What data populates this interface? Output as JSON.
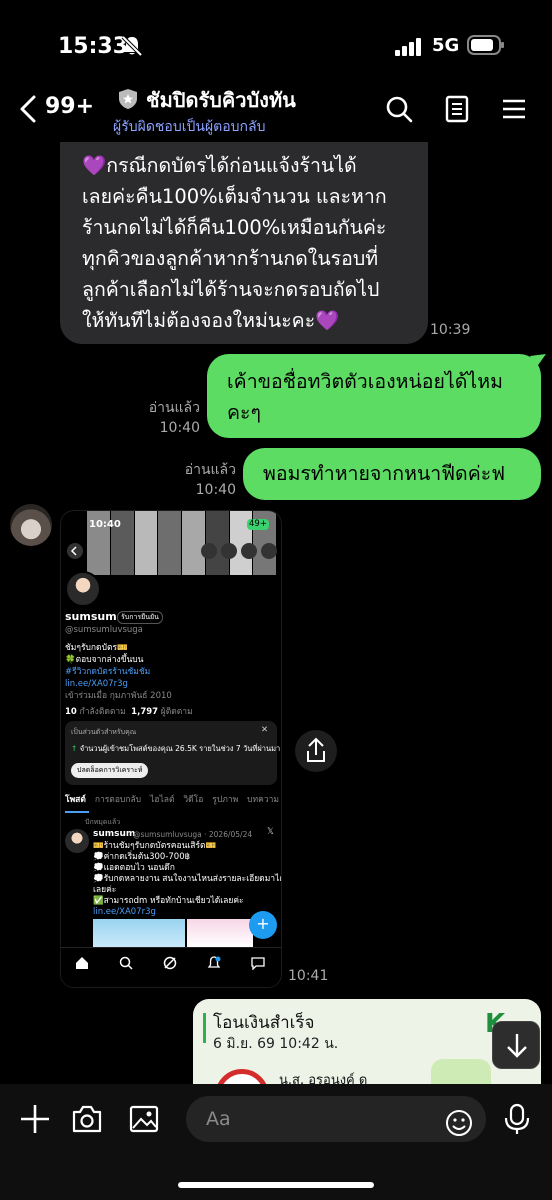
{
  "status_bar": {
    "time": "15:33",
    "network": "5G"
  },
  "header": {
    "unread_count": "99+",
    "title": "ชัมปิดรับคิวบังทัน",
    "subtitle": "ผู้รับผิดชอบเป็นผู้ตอบกลับ"
  },
  "messages": [
    {
      "direction": "in",
      "lines": [
        "💜กรณีกดบัตรได้ก่อนแจ้งร้านได้",
        "เลยค่ะคืน100%เต็มจำนวน และหาก",
        "ร้านกดไม่ได้ก็คืน100%เหมือนกันค่ะ",
        "ทุกคิวของลูกค้าหากร้านกดในรอบที่",
        "ลูกค้าเลือกไม่ได้ร้านจะกดรอบถัดไป",
        "ให้ทันทีไม่ต้องจองใหม่นะคะ💜"
      ],
      "time": "10:39"
    },
    {
      "direction": "out",
      "lines": [
        "เค้าขอชื่อทวิตตัวเองหน่อยได้ไหม",
        "คะๆ"
      ],
      "read_label": "อ่านแล้ว",
      "time": "10:40"
    },
    {
      "direction": "out",
      "lines": [
        "พอมรทำหายจากหนาฟีดค่ะฟ"
      ],
      "read_label": "อ่านแล้ว",
      "time": "10:40"
    },
    {
      "direction": "in",
      "type": "image",
      "time": "10:41"
    }
  ],
  "profile_shot": {
    "time": "10:40",
    "battery": "49+",
    "name": "sumsum",
    "badge": "รับการยืนยัน",
    "handle": "@sumsumluvsuga",
    "bio1": "ชัมๆรับกดบัตร🎫",
    "bio2": "🍀ตอบจากล่างขึ้นบน",
    "bio3": "#รีวิวกดบัตรร้านชัมชัม",
    "link": "lin.ee/XA07r3g",
    "joined": "เข้าร่วมเมื่อ กุมภาพันธ์ 2010",
    "following_count": "10",
    "following_label": "กำลังติดตาม",
    "followers_count": "1,797",
    "followers_label": "ผู้ติดตาม",
    "card_title": "เป็นส่วนตัวสำหรับคุณ",
    "card_text": "จำนวนผู้เข้าชมโพสต์ของคุณ 26.5K รายในช่วง 7 วันที่ผ่านมา",
    "card_button": "ปลดล็อคการวิเคราะห์",
    "tabs": [
      "โพสต์",
      "การตอบกลับ",
      "ไฮไลต์",
      "วิดีโอ",
      "รูปภาพ",
      "บทความ"
    ],
    "pinned": "ปักหมุดแล้ว",
    "post_name": "sumsum",
    "post_meta": "@sumsumluvsuga · 2026/05/24",
    "post_lines": [
      "🎫ร้านชัมๆรับกดบัตรคอนเสิร์ต🎫",
      "💭ค่ากดเริ่มต้น300-700฿",
      "💭แอดตอบไว นอนดึก",
      "💭รับกดหลายงาน สนใจงานไหนส่งรายละเอียดมาได้",
      "เลยค่ะ",
      "✅สามารถdm หรือทักบ้านเชียวได้เลยค่ะ"
    ],
    "post_link": "lin.ee/XA07r3g"
  },
  "receipt": {
    "title": "โอนเงินสำเร็จ",
    "date": "6 มิ.ย. 69  10:42 น.",
    "name": "น.ส. อรอนงค์ ด"
  },
  "input": {
    "placeholder": "Aa"
  },
  "colors": {
    "outgoing_bubble": "#5ddc63",
    "incoming_bubble": "#2b2b2d",
    "subtitle": "#8da1ff"
  }
}
